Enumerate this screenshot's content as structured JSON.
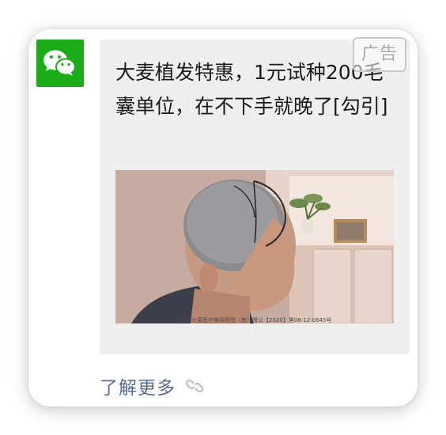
{
  "ad": {
    "badge": "广告",
    "title": "大麦植发特惠，1元试种200毛囊单位，在不下手就晚了[勾引]",
    "photo_caption": "沪卫大麦医疗美容医院（有）限公【2020】第08-12-0845号",
    "icon": "wechat-logo",
    "brand_color": "#1aad19"
  },
  "footer": {
    "learn_more_label": "了解更多",
    "link_color": "#576b95",
    "icon": "link-icon"
  }
}
